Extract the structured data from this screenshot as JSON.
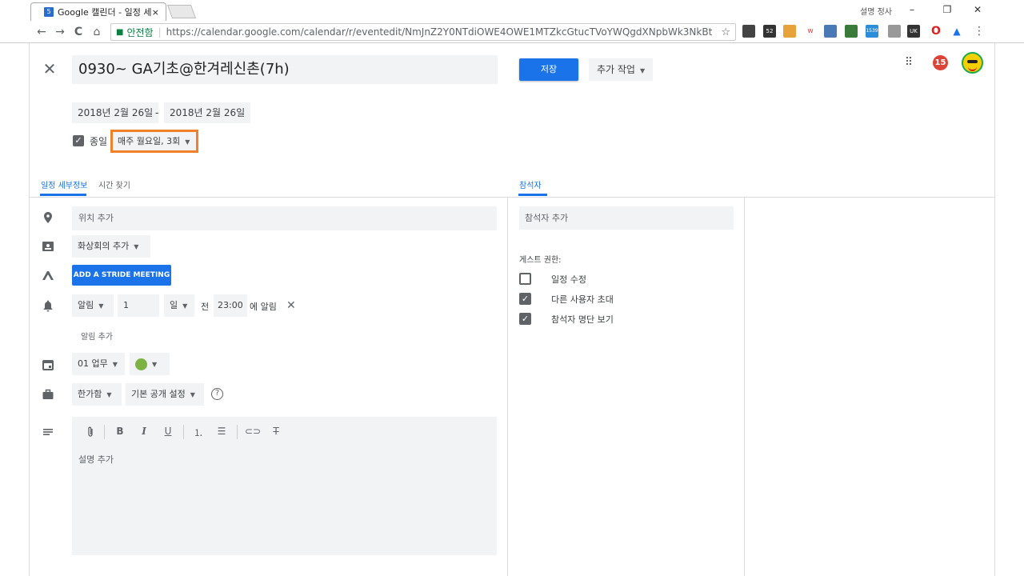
{
  "browser": {
    "tab_favicon": "5",
    "tab_title": "Google 캘린더 - 일정 세",
    "tab_close": "×",
    "user_label": "설명 정사",
    "window_buttons": [
      "–",
      "❐",
      "✕"
    ],
    "nav": {
      "back": "←",
      "forward": "→",
      "reload": "C",
      "home": "⌂"
    },
    "secure_label": "안전함",
    "url": "https://calendar.google.com/calendar/r/eventedit/NmJnZ2Y0NTdiOWE4OWE1MTZkcGtucTVoYWQgdXNpbWk3NkBt",
    "bookmark_star": "☆",
    "extension_badges": [
      "52",
      "1539",
      "UK"
    ],
    "menu": "⋮"
  },
  "header": {
    "close_icon": "✕",
    "title": "0930~ GA기초@한겨레신촌(7h)",
    "save_label": "저장",
    "more_actions_label": "추가 작업",
    "apps_icon": "⠿",
    "notification_count": "15"
  },
  "dates": {
    "start": "2018년 2월 26일",
    "separator": "-",
    "end": "2018년 2월 26일",
    "all_day_label": "종일",
    "recurrence": "매주 월요일, 3회"
  },
  "tabs": {
    "details": "일정 세부정보",
    "find_time": "시간 찾기",
    "guests": "참석자"
  },
  "details": {
    "location_placeholder": "위치 추가",
    "conference_label": "화상회의 추가",
    "stride_button": "ADD A STRIDE MEETING",
    "notification": {
      "type": "알림",
      "amount": "1",
      "unit": "일",
      "before_label": "전",
      "time": "23:00",
      "suffix": "에 알림"
    },
    "add_notification": "알림 추가",
    "calendar_name": "01 업무",
    "event_color": "#7cb342",
    "busy_status": "한가함",
    "visibility": "기본 공개 설정",
    "description_placeholder": "설명 추가"
  },
  "guests_panel": {
    "add_guests_placeholder": "참석자 추가",
    "permissions_title": "게스트 권한:",
    "permissions": [
      {
        "label": "일정 수정",
        "checked": false
      },
      {
        "label": "다른 사용자 초대",
        "checked": true
      },
      {
        "label": "참석자 명단 보기",
        "checked": true
      }
    ]
  },
  "colors": {
    "accent": "#1a73e8",
    "highlight": "#f0812a",
    "field_bg": "#f1f3f4"
  }
}
